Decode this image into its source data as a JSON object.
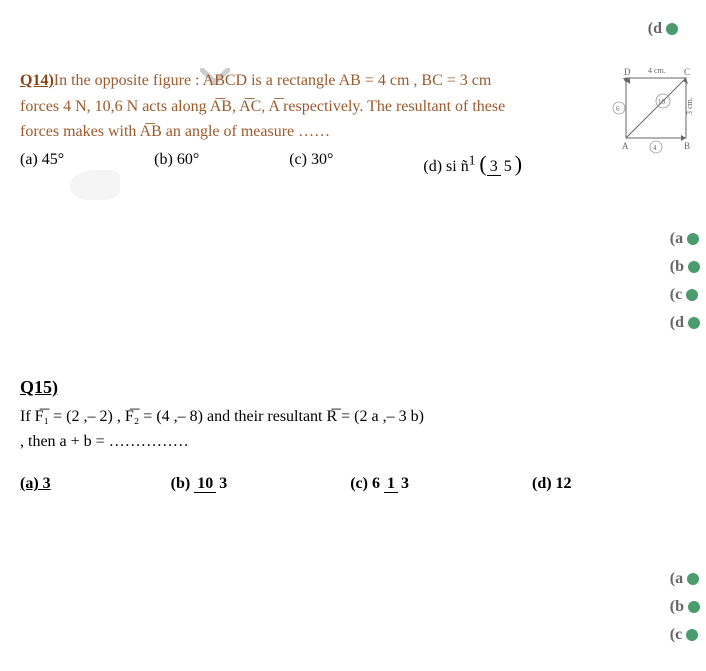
{
  "top": {
    "d_label": "(d"
  },
  "q14": {
    "label": "Q14)",
    "text1": "In the opposite figure : ABCD is a rectangle AB = 4 cm , BC = 3 cm",
    "text2": "forces 4 N, 10,6 N acts  along A͞B, A͞C, A͞ respectively. The resultant of these",
    "text3": "forces makes with A͞B an angle of measure ……",
    "opts": {
      "a": "(a) 45°",
      "b": "(b) 60°",
      "c": "(c) 30°",
      "d_prefix": "(d) si ñ",
      "d_sup": "1",
      "d_frac_num": "3",
      "d_frac_den": "5"
    },
    "figure": {
      "top_label": "4 cm.",
      "right_label": "3 cm.",
      "D": "D",
      "C": "C",
      "A": "A",
      "B": "B",
      "left_force": "6",
      "diag_force": "10",
      "bottom_force": "4"
    }
  },
  "side1": {
    "a": "(a",
    "b": "(b",
    "c": "(c",
    "d": "(d"
  },
  "q15": {
    "label": "Q15)",
    "line1_pre": "If F͞₁ = (2 ,– 2)  ,  F͞₂ = (4 ,– 8) and their resultant R͞ = (2 a ,– 3 b)",
    "line2": ", then a + b = ……………",
    "opts": {
      "a": "(a) 3",
      "b_pre": "(b) ",
      "b_num": "10",
      "b_den": "3",
      "c_pre": "(c) 6 ",
      "c_num": "1",
      "c_den": "3",
      "d": "(d) 12"
    }
  },
  "side2": {
    "a": "(a",
    "b": "(b",
    "c": "(c"
  }
}
